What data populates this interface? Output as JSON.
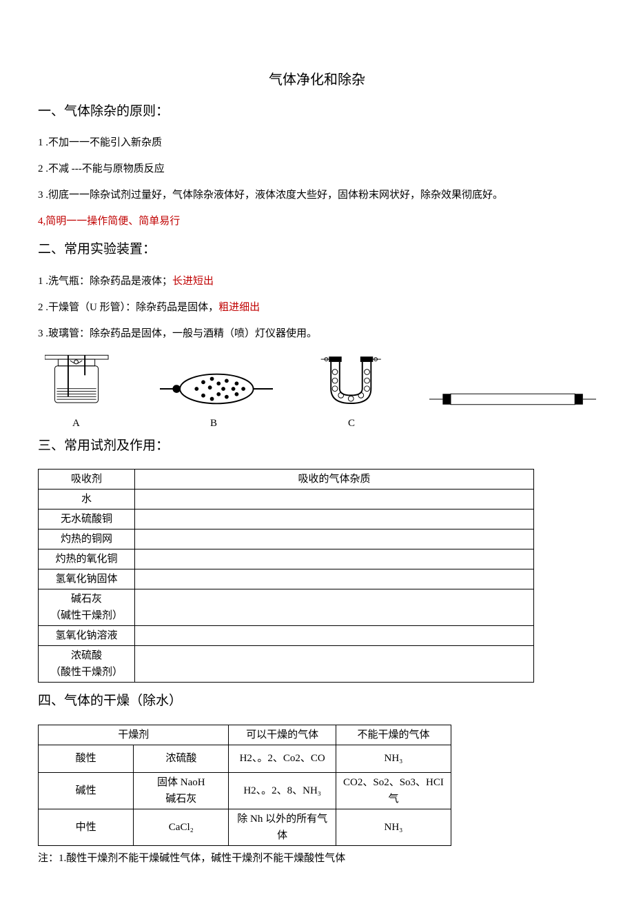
{
  "title": "气体净化和除杂",
  "s1": {
    "heading": "一、气体除杂的原则：",
    "i1": "1 .不加一一不能引入新杂质",
    "i2": "2 .不减 ---不能与原物质反应",
    "i3": "3 .彻底一一除杂试剂过量好，气体除杂液体好，液体浓度大些好，固体粉末网状好，除杂效果彻底好。",
    "i4": "4,简明一一操作简便、简单易行"
  },
  "s2": {
    "heading": "二、常用实验装置：",
    "i1a": "1 .洗气瓶：除杂药品是液体；",
    "i1b": "长进短出",
    "i2a": "2 .干燥管（U 形管）：除杂药品是固体，",
    "i2b": "粗进细出",
    "i3": "3 .玻璃管：除杂药品是固体，一般与酒精（喷）灯仪器使用。",
    "labels": {
      "a": "A",
      "b": "B",
      "c": "C"
    }
  },
  "s3": {
    "heading": "三、常用试剂及作用：",
    "headerA": "吸收剂",
    "headerB": "吸收的气体杂质",
    "rows": [
      "水",
      "无水硫酸铜",
      "灼热的铜网",
      "灼热的氧化铜",
      "氢氧化钠固体",
      "碱石灰\n（碱性干燥剂）",
      "氢氧化钠溶液",
      "浓硫酸\n（酸性干燥剂）"
    ]
  },
  "s4": {
    "heading": "四、气体的干燥（除水）",
    "h1": "干燥剂",
    "h2": "可以干燥的气体",
    "h3": "不能干燥的气体",
    "r1c1": "酸性",
    "r1c2": "浓硫酸",
    "r1c3": "H2、。2、Co2、CO",
    "r1c4": "NH₃",
    "r2c1": "碱性",
    "r2c2": "固体 NaoH\n碱石灰",
    "r2c3": "H2、。2、8、NH₃",
    "r2c4": "CO2、So2、So3、HCI 气",
    "r3c1": "中性",
    "r3c2": "CaCl₂",
    "r3c3": "除 Nh 以外的所有气体",
    "r3c4": "NH₃",
    "note": "注：1.酸性干燥剂不能干燥碱性气体，碱性干燥剂不能干燥酸性气体"
  }
}
